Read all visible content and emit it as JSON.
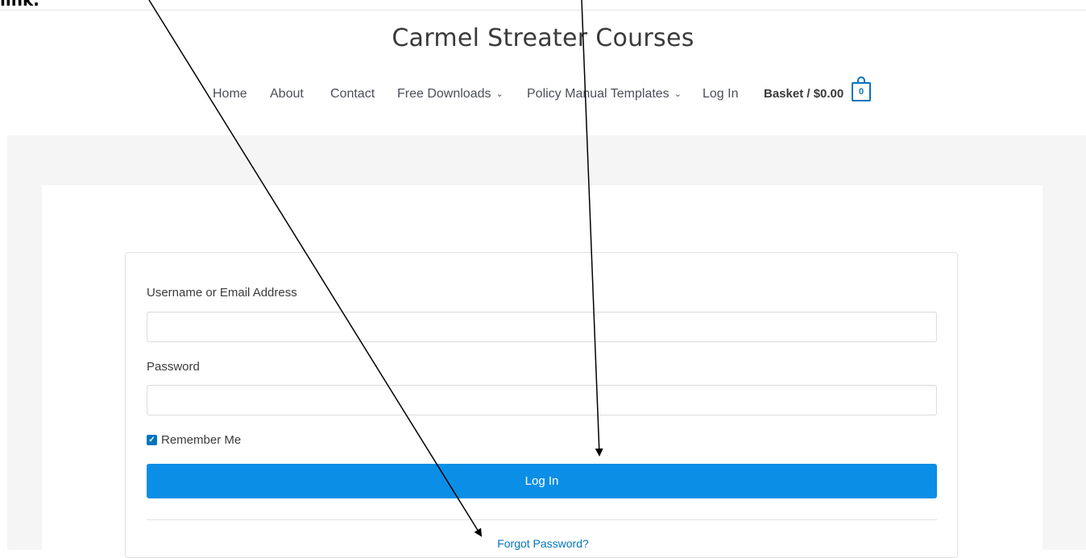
{
  "annotation": {
    "top_text": "link."
  },
  "header": {
    "site_title": "Carmel Streater Courses",
    "nav": [
      {
        "label": "Home"
      },
      {
        "label": "About"
      },
      {
        "label": "Contact"
      },
      {
        "label": "Free Downloads",
        "has_dropdown": true
      },
      {
        "label": "Policy Manual Templates",
        "has_dropdown": true
      },
      {
        "label": "Log In"
      }
    ],
    "basket_label": "Basket / $0.00",
    "basket_count": "0",
    "chevron": "⌄"
  },
  "login_form": {
    "username_label": "Username or Email Address",
    "username_value": "",
    "password_label": "Password",
    "password_value": "",
    "remember_label": "Remember Me",
    "remember_checked": true,
    "submit_label": "Log In",
    "forgot_label": "Forgot Password?"
  },
  "colors": {
    "accent": "#0274be",
    "button": "#0b8ee5",
    "page_bg": "#f5f5f5"
  },
  "icons": [
    "shopping-bag-icon",
    "chevron-down-icon",
    "checkbox-checked-icon"
  ]
}
